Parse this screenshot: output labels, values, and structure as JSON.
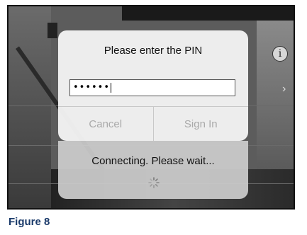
{
  "dialog": {
    "title": "Please enter the PIN",
    "pin_value": "••••••",
    "cancel_label": "Cancel",
    "signin_label": "Sign In"
  },
  "status": {
    "message": "Connecting. Please wait..."
  },
  "icons": {
    "info": "info-icon",
    "chevron": "chevron-right-icon",
    "spinner": "spinner-icon"
  },
  "info_glyph": "i",
  "chevron_glyph": "›",
  "caption": "Figure 8"
}
